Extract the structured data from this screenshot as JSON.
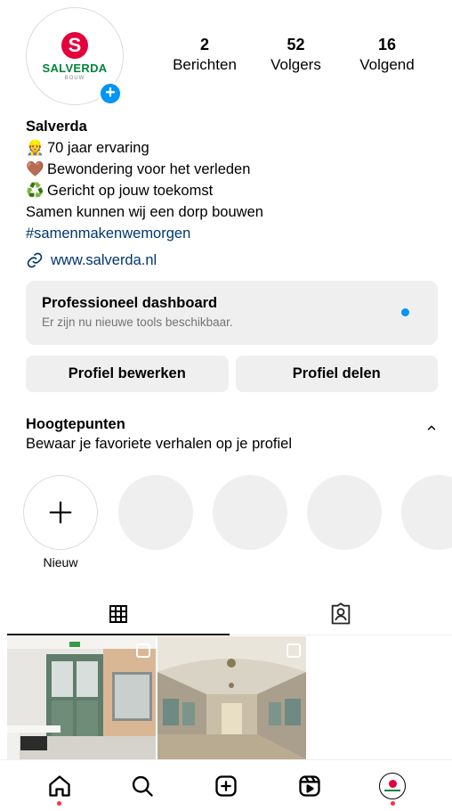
{
  "profile": {
    "logo_letter": "S",
    "logo_word": "SALVERDA",
    "logo_sub": "BOUW",
    "add_badge": "+",
    "stats": [
      {
        "num": "2",
        "label": "Berichten"
      },
      {
        "num": "52",
        "label": "Volgers"
      },
      {
        "num": "16",
        "label": "Volgend"
      }
    ]
  },
  "bio": {
    "name": "Salverda",
    "lines": [
      {
        "emoji": "👷",
        "text": "70 jaar ervaring"
      },
      {
        "emoji": "🤎",
        "text": "Bewondering voor het verleden"
      },
      {
        "emoji": "♻️",
        "text": "Gericht op jouw toekomst"
      }
    ],
    "plain_line": "Samen kunnen wij een dorp bouwen",
    "hashtag": "#samenmakenwemorgen",
    "link": "www.salverda.nl"
  },
  "dashboard": {
    "title": "Professioneel dashboard",
    "subtitle": "Er zijn nu nieuwe tools beschikbaar."
  },
  "buttons": {
    "edit": "Profiel bewerken",
    "share": "Profiel delen"
  },
  "highlights": {
    "title": "Hoogtepunten",
    "subtitle": "Bewaar je favoriete verhalen op je profiel",
    "new_label": "Nieuw"
  },
  "colors": {
    "accent_blue": "#0095f6",
    "link_blue": "#00376b",
    "brand_red": "#e4003b",
    "brand_green": "#00843d",
    "notification_red": "#ff3040"
  },
  "icons": {
    "tabs": [
      "grid-icon",
      "tagged-icon"
    ],
    "nav": [
      "home-icon",
      "search-icon",
      "create-icon",
      "reels-icon",
      "profile-avatar"
    ]
  }
}
